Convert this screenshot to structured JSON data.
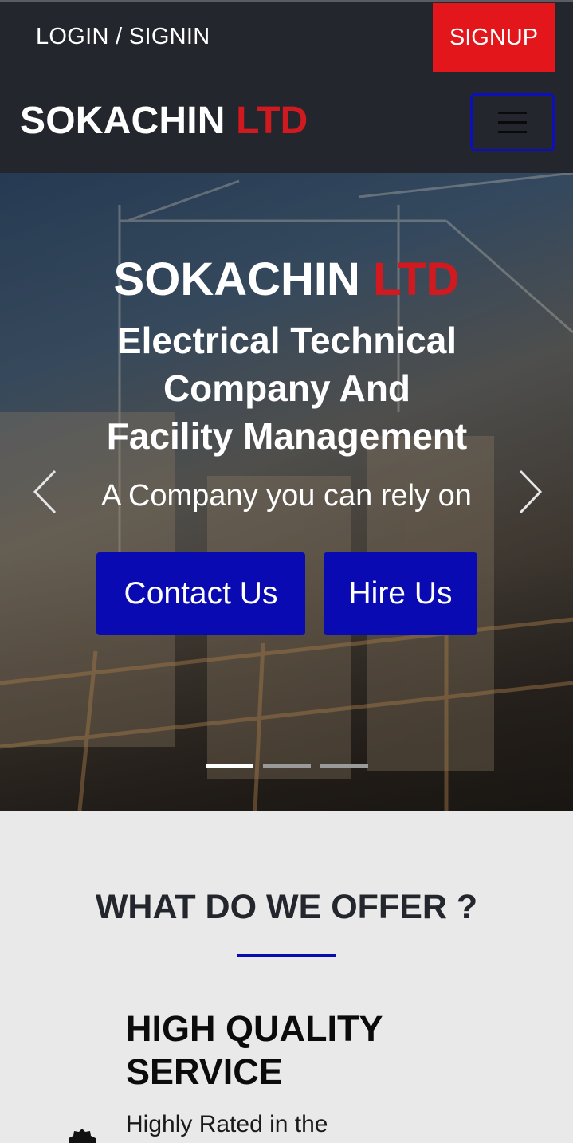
{
  "topbar": {
    "login_label": "LOGIN / SIGNIN",
    "signup_label": "SIGNUP"
  },
  "navbar": {
    "brand_main": "SOKACHIN",
    "brand_accent": "LTD",
    "menu_icon": "hamburger-icon"
  },
  "hero": {
    "title_main": "SOKACHIN",
    "title_accent": "LTD",
    "subtitle_line1": "Electrical Technical",
    "subtitle_line2": "Company And",
    "subtitle_line3": "Facility Management",
    "tagline": "A Company you can rely on",
    "contact_label": "Contact Us",
    "hire_label": "Hire Us",
    "prev_icon": "chevron-left-icon",
    "next_icon": "chevron-right-icon",
    "slide_count": 3,
    "active_slide": 1
  },
  "offer": {
    "heading": "WHAT DO WE OFFER ?",
    "service_title_line1": "HIGH QUALITY",
    "service_title_line2": "SERVICE",
    "service_desc": "Highly Rated in the",
    "service_icon": "badge-icon"
  },
  "colors": {
    "dark_bg": "#23262c",
    "accent_red": "#d01a1f",
    "signup_red": "#e3161b",
    "button_blue": "#0a0ab2",
    "section_bg": "#e9e9e9"
  }
}
